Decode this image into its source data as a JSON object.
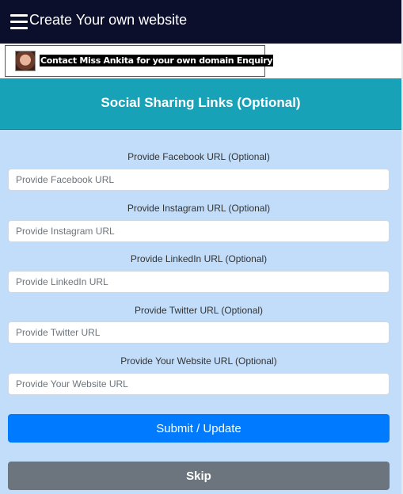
{
  "header": {
    "title": "Create Your own website"
  },
  "promo": {
    "text": "Contact Miss Ankita for your own domain Enquiry"
  },
  "section": {
    "title": "Social Sharing Links (Optional)"
  },
  "fields": [
    {
      "label": "Provide Facebook URL (Optional)",
      "placeholder": "Provide Facebook URL",
      "value": ""
    },
    {
      "label": "Provide Instagram URL (Optional)",
      "placeholder": "Provide Instagram URL",
      "value": ""
    },
    {
      "label": "Provide LinkedIn URL (Optional)",
      "placeholder": "Provide LinkedIn URL",
      "value": ""
    },
    {
      "label": "Provide Twitter URL (Optional)",
      "placeholder": "Provide Twitter URL",
      "value": ""
    },
    {
      "label": "Provide Your Website URL (Optional)",
      "placeholder": "Provide Your Website URL",
      "value": ""
    }
  ],
  "buttons": {
    "submit": "Submit / Update",
    "skip": "Skip"
  },
  "colors": {
    "topbar": "#0c0f2b",
    "section_header": "#17a2b8",
    "form_background": "#c1ddfa",
    "primary": "#007bff",
    "secondary": "#6c757d"
  },
  "icons": {
    "menu": "hamburger-menu-icon",
    "avatar": "profile-photo"
  }
}
